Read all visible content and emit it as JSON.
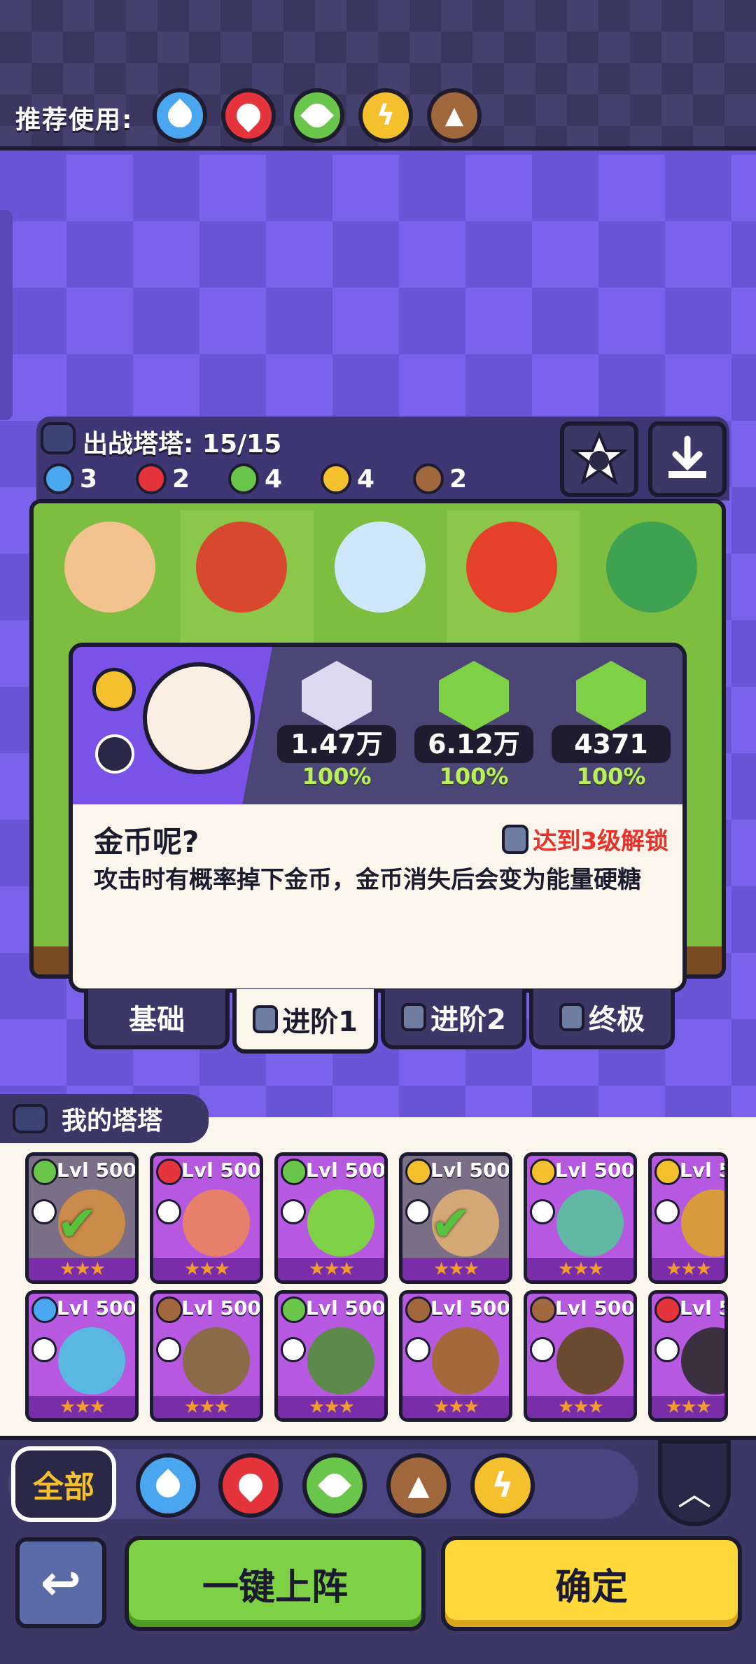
{
  "header": {
    "recommend_label": "推荐使用:",
    "recommended_elements": [
      "water-icon",
      "fire-icon",
      "leaf-icon",
      "lightning-icon",
      "earth-icon"
    ]
  },
  "team": {
    "title": "出战塔塔: 15/15",
    "counts": [
      {
        "element": "water-icon",
        "count": "3"
      },
      {
        "element": "fire-icon",
        "count": "2"
      },
      {
        "element": "leaf-icon",
        "count": "4"
      },
      {
        "element": "lightning-icon",
        "count": "4"
      },
      {
        "element": "earth-icon",
        "count": "2"
      }
    ]
  },
  "popup": {
    "stats": [
      {
        "icon": "sword-icon",
        "value": "1.47万",
        "percent": "100%"
      },
      {
        "icon": "heart-icon",
        "value": "6.12万",
        "percent": "100%"
      },
      {
        "icon": "shield-icon",
        "value": "4371",
        "percent": "100%"
      }
    ],
    "skill_name": "金币呢?",
    "unlock_text": "达到3级解锁",
    "description": "攻击时有概率掉下金币，金币消失后会变为能量硬糖"
  },
  "tabs": [
    "基础",
    "进阶1",
    "进阶2",
    "终极"
  ],
  "my_towers": {
    "title": "我的塔塔",
    "cards_row1": [
      {
        "level": "Lvl 500",
        "element": "leaf-icon",
        "dim": true
      },
      {
        "level": "Lvl 500",
        "element": "fire-icon",
        "dim": false
      },
      {
        "level": "Lvl 500",
        "element": "leaf-icon",
        "dim": false
      },
      {
        "level": "Lvl 500",
        "element": "lightning-icon",
        "dim": true
      },
      {
        "level": "Lvl 500",
        "element": "lightning-icon",
        "dim": false
      },
      {
        "level": "Lvl 5",
        "element": "lightning-icon",
        "dim": false
      }
    ],
    "cards_row2": [
      {
        "level": "Lvl 500",
        "element": "water-icon"
      },
      {
        "level": "Lvl 500",
        "element": "earth-icon"
      },
      {
        "level": "Lvl 500",
        "element": "leaf-icon"
      },
      {
        "level": "Lvl 500",
        "element": "earth-icon"
      },
      {
        "level": "Lvl 500",
        "element": "earth-icon"
      },
      {
        "level": "Lvl 5",
        "element": "fire-icon"
      }
    ],
    "stars": "★★★"
  },
  "filters": {
    "all_label": "全部",
    "elements": [
      "water-icon",
      "fire-icon",
      "leaf-icon",
      "earth-icon",
      "lightning-icon"
    ]
  },
  "buttons": {
    "auto_deploy": "一键上阵",
    "confirm": "确定"
  }
}
